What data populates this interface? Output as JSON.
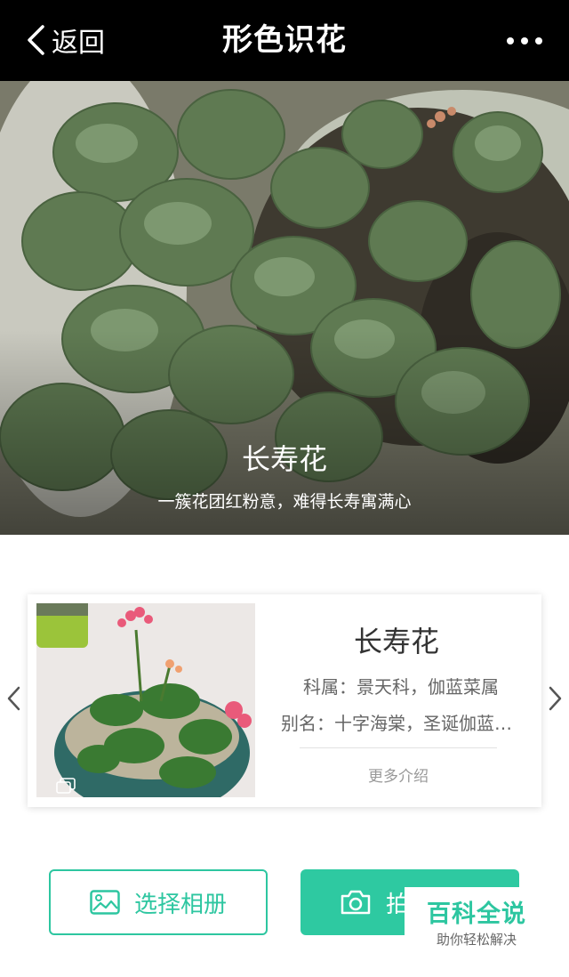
{
  "topbar": {
    "back_label": "返回",
    "title": "形色识花",
    "more_icon": "more-dots-icon"
  },
  "hero": {
    "name": "长寿花",
    "tagline": "一簇花团红粉意，难得长寿寓满心"
  },
  "card": {
    "name": "长寿花",
    "family": "科属：景天科，伽蓝菜属",
    "alias": "别名：十字海棠，圣诞伽蓝…",
    "more_label": "更多介绍"
  },
  "buttons": {
    "album_label": "选择相册",
    "photo_label": "拍照"
  },
  "watermark": {
    "main": "百科全说",
    "sub": "助你轻松解决"
  },
  "colors": {
    "accent": "#2dc6a0",
    "topbar_bg": "#000000"
  }
}
